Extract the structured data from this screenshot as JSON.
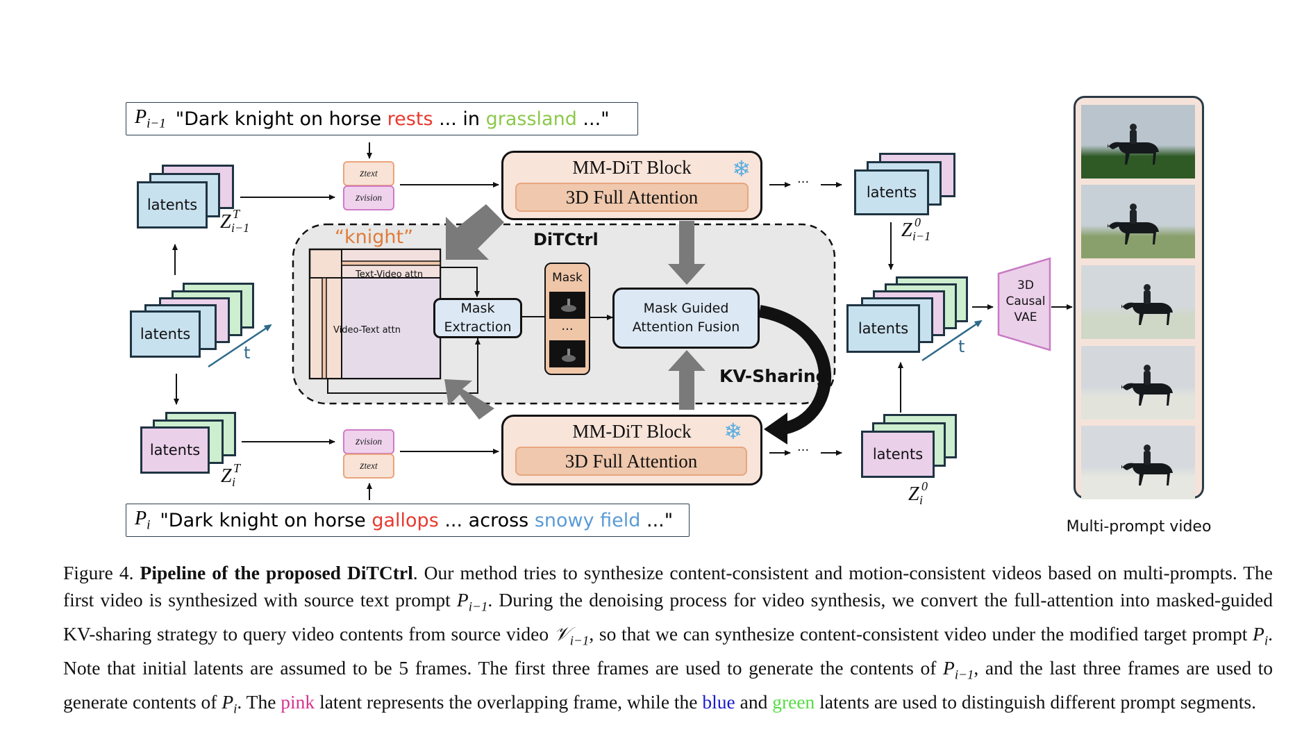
{
  "prompts": {
    "top": {
      "symbol": "P",
      "subscript": "i−1",
      "parts": [
        {
          "text": "\"Dark knight on horse ",
          "color": "#000000"
        },
        {
          "text": "rests",
          "color": "#e8392e"
        },
        {
          "text": " ... in ",
          "color": "#000000"
        },
        {
          "text": "grassland",
          "color": "#8cc84b"
        },
        {
          "text": " ...\"",
          "color": "#000000"
        }
      ]
    },
    "bottom": {
      "symbol": "P",
      "subscript": "i",
      "parts": [
        {
          "text": "\"Dark knight on horse ",
          "color": "#000000"
        },
        {
          "text": "gallops",
          "color": "#e8392e"
        },
        {
          "text": " ... across ",
          "color": "#000000"
        },
        {
          "text": "snowy field",
          "color": "#5b9bd5"
        },
        {
          "text": " ...\"",
          "color": "#000000"
        }
      ]
    }
  },
  "latents": {
    "label": "latents",
    "top_left": {
      "sym": "Z",
      "sup": "T",
      "sub": "i−1"
    },
    "bottom_left": {
      "sym": "Z",
      "sup": "T",
      "sub": "i"
    },
    "top_right": {
      "sym": "Z",
      "sup": "0",
      "sub": "i−1"
    },
    "bottom_right": {
      "sym": "Z",
      "sup": "0",
      "sub": "i"
    },
    "time_axis": "t"
  },
  "embeddings": {
    "text": {
      "sym": "z",
      "sub": "text"
    },
    "vision": {
      "sym": "z",
      "sub": "vision"
    }
  },
  "mmdit": {
    "title": "MM-DiT Block",
    "inner": "3D Full Attention",
    "frozen_icon": "❄"
  },
  "ditctrl": {
    "title": "DiTCtrl",
    "token": "“knight”",
    "text_video_attn": "Text-Video attn",
    "video_text_attn": "Video-Text attn",
    "mask_extraction": [
      "Mask",
      "Extraction"
    ],
    "mask_label": "Mask",
    "mask_ellipsis": "···",
    "fusion": [
      "Mask Guided",
      "Attention Fusion"
    ],
    "kv_sharing": "KV-Sharing"
  },
  "flow": {
    "ellipsis": "···"
  },
  "vae": {
    "lines": [
      "3D",
      "Causal",
      "VAE"
    ]
  },
  "video": {
    "label": "Multi-prompt video",
    "frames": [
      {
        "scene": "grassland",
        "ground": "#2f5a26",
        "sky": "#b9c4cc"
      },
      {
        "scene": "grassland-light",
        "ground": "#8aa06c",
        "sky": "#c7d0d6"
      },
      {
        "scene": "snowy-grass",
        "ground": "#cfd8c6",
        "sky": "#d3d8dc"
      },
      {
        "scene": "snowy-field",
        "ground": "#e2e4dc",
        "sky": "#d4d8dc"
      },
      {
        "scene": "snowy-field",
        "ground": "#e6e7e0",
        "sky": "#d6d9dd"
      }
    ]
  },
  "caption": {
    "figure_label": "Figure 4.",
    "bold_title": "Pipeline of the proposed DiTCtrl",
    "segments": [
      {
        "t": ". Our method tries to synthesize content-consistent and motion-consistent videos based on multi-prompts. The first video is synthesized with source text prompt ",
        "s": "normal"
      },
      {
        "t": "P",
        "s": "math"
      },
      {
        "t": "i−1",
        "s": "mathsub"
      },
      {
        "t": ". During the denoising process for video synthesis, we convert the full-attention into masked-guided KV-sharing strategy to query video contents from source video ",
        "s": "normal"
      },
      {
        "t": "𝒱",
        "s": "math"
      },
      {
        "t": "i−1",
        "s": "mathsub"
      },
      {
        "t": ", so that we can synthesize content-consistent video under the modified target prompt ",
        "s": "normal"
      },
      {
        "t": "P",
        "s": "math"
      },
      {
        "t": "i",
        "s": "mathsub"
      },
      {
        "t": ". Note that initial latents are assumed to be 5 frames. The first three frames are used to generate the contents of ",
        "s": "normal"
      },
      {
        "t": "P",
        "s": "math"
      },
      {
        "t": "i−1",
        "s": "mathsub"
      },
      {
        "t": ", and the last three frames are used to generate contents of ",
        "s": "normal"
      },
      {
        "t": "P",
        "s": "math"
      },
      {
        "t": "i",
        "s": "mathsub"
      },
      {
        "t": ". The ",
        "s": "normal"
      },
      {
        "t": "pink",
        "s": "pink"
      },
      {
        "t": " latent represents the overlapping frame, while the ",
        "s": "normal"
      },
      {
        "t": "blue",
        "s": "blue"
      },
      {
        "t": " and ",
        "s": "normal"
      },
      {
        "t": "green",
        "s": "green"
      },
      {
        "t": " latents are used to distinguish different prompt segments.",
        "s": "normal"
      }
    ]
  }
}
